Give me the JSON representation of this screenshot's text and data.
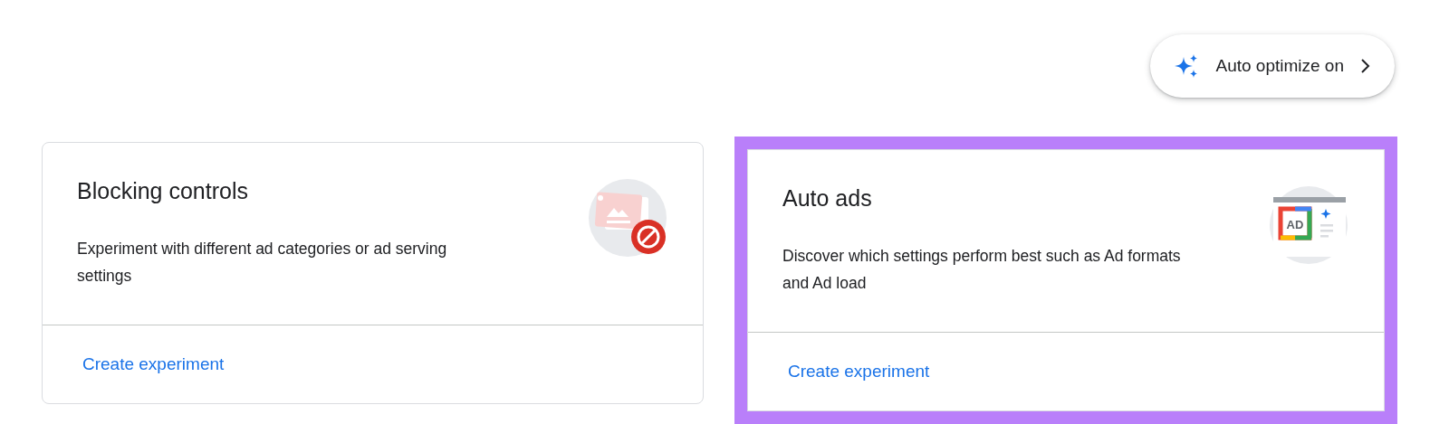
{
  "auto_optimize_button": {
    "label": "Auto optimize on"
  },
  "cards": [
    {
      "kind": "blocking",
      "title": "Blocking controls",
      "description": "Experiment with different ad categories or ad serving settings",
      "link": "Create experiment",
      "highlighted": false
    },
    {
      "kind": "auto-ads",
      "title": "Auto ads",
      "description": "Discover which settings perform best such as Ad formats and Ad load",
      "link": "Create experiment",
      "highlighted": true,
      "icon_label": "AD"
    }
  ]
}
